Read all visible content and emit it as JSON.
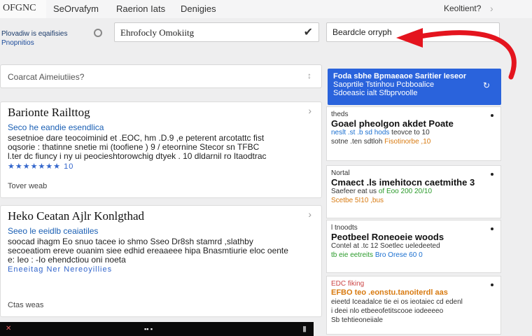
{
  "topbar": {
    "brand": "OFGNC",
    "nav": [
      "SeOrvafym",
      "Raerion Iats",
      "Denigies"
    ],
    "right_label": "Keoltient?"
  },
  "filters": {
    "label_line1": "Plovadiw is eqaifisies",
    "label_line2": "Pnopnitios",
    "field_value": "Ehrofocly Omokiitg",
    "target_value": "Beardcle orryph"
  },
  "search": {
    "placeholder": "Coarcat Aimeiutiies?"
  },
  "cards": [
    {
      "title": "Barionte Railttog",
      "subtitle": "Seco he eandie esendlica",
      "desc": [
        "sesetnioe dare teocoiminid et .EOC, hm .D.9 ,e peterent arcotattc fist",
        "oqsorie : thatinne snetie mi (toofiene ) 9 / eteornine Stecor sn TFBC",
        "l.ter dc fiuncy i ny ui peocieshtorowchig dtyek . 10 dldarnil ro Itaodtrac"
      ],
      "rating": "★★★★★★★ 10",
      "footer": "Tover weab"
    },
    {
      "title": "Heko Ceatan Ajlr Konlgthad",
      "subtitle": "Seeo le eeidlb ceaiatiles",
      "desc": [
        "soocad ihagm Eo snuo tacee io shmo Sseo Dr8sh stamrd ,slathby",
        "secoeatiom ereve ouanim siee edhid ereaaeee hipa Bnasmtiurie eloc oente",
        "e: Ieo : -Io ehendctiou oni noeta"
      ],
      "rating": "Eneeitag Ner Nereoyillies",
      "footer": "Ctas weas"
    }
  ],
  "blue_card": {
    "lines": [
      "Foda sbhe Bpmaeaoe Saritier Ieseor",
      "Saoprtile Tstinhou Pcbboalice",
      "Sdoeasic ialt Sfbprvoolle"
    ]
  },
  "right_cards": [
    {
      "kicker": "theds",
      "head": "Goael pheolgon akdet Poate",
      "meta1": "neslt .st .b sd hods",
      "meta2": "sotne .ten sdtloh",
      "meta_tail": "teovce to 10",
      "meta_tail2": "Fisotinorbe ,10"
    },
    {
      "kicker": "Nortal",
      "head": "Cmaect .ls imehitocn caetmithe 3",
      "meta1": "Saefeer eat us",
      "meta2": "Scetbe 5I10 ,bus",
      "meta_tail": "of Eoo 200 20/10"
    },
    {
      "kicker": "l tnoodts",
      "head": "Peotbeel Roneoeie woods",
      "meta1": "Contel at .tc 12 Soetlec ueledeeted",
      "meta2": "tb eie eetreits",
      "meta_tail": "Bro Orese 60 0"
    },
    {
      "kicker": "EDC fiking",
      "head": "EFBO teo .eonstu.tanoiterdl aas",
      "meta1": "eieetd Iceadalce tie ei os ieotaiec cd edenl",
      "meta2": "i deei nlo etbeeofetitscooe iodeeeeo",
      "meta_tail": "Sb tehtieoneiiale"
    }
  ]
}
